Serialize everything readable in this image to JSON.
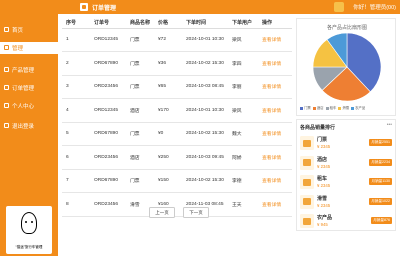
{
  "header": {
    "title": "订单管理",
    "user_greeting": "你好！管理员(00)"
  },
  "sidebar": {
    "items": [
      {
        "label": "首页"
      },
      {
        "label": "管理"
      },
      {
        "label": "产品管理"
      },
      {
        "label": "订单管理"
      },
      {
        "label": "个人中心"
      },
      {
        "label": "退出登录"
      }
    ],
    "slogan": "“猫途”旅行车管理"
  },
  "orders": {
    "columns": [
      "序号",
      "订单号",
      "商品名称",
      "价格",
      "下单时间",
      "下单用户",
      "操作"
    ],
    "rows": [
      {
        "no": "1",
        "order_id": "ORD12345",
        "product": "门票",
        "price": "¥72",
        "time": "2024-10-01 10:30",
        "user": "梁风",
        "action": "查看详情"
      },
      {
        "no": "2",
        "order_id": "ORD67890",
        "product": "门票",
        "price": "¥36",
        "time": "2024-10-02 15:30",
        "user": "李四",
        "action": "查看详情"
      },
      {
        "no": "3",
        "order_id": "ORD23456",
        "product": "门票",
        "price": "¥65",
        "time": "2024-10-03 08:45",
        "user": "李丽",
        "action": "查看详情"
      },
      {
        "no": "4",
        "order_id": "ORD12345",
        "product": "酒店",
        "price": "¥170",
        "time": "2024-10-01 10:30",
        "user": "梁风",
        "action": "查看详情"
      },
      {
        "no": "5",
        "order_id": "ORD67890",
        "product": "门票",
        "price": "¥0",
        "time": "2024-10-02 15:30",
        "user": "魏大",
        "action": "查看详情"
      },
      {
        "no": "6",
        "order_id": "ORD23456",
        "product": "酒店",
        "price": "¥250",
        "time": "2024-10-03 09:45",
        "user": "阿娇",
        "action": "查看详情"
      },
      {
        "no": "7",
        "order_id": "ORD67890",
        "product": "门票",
        "price": "¥150",
        "time": "2024-10-02 15:30",
        "user": "李德",
        "action": "查看详情"
      },
      {
        "no": "8",
        "order_id": "ORD23456",
        "product": "滑雪",
        "price": "¥160",
        "time": "2024-11-03 08:45",
        "user": "王天",
        "action": "查看详情"
      }
    ]
  },
  "pagination": {
    "prev": "上一页",
    "next": "下一页"
  },
  "chart_data": {
    "type": "pie",
    "title": "各产品占比扇形图",
    "categories": [
      "门票",
      "酒店",
      "租车",
      "滑雪",
      "农产品"
    ],
    "values": [
      38,
      25,
      12,
      15,
      10
    ],
    "colors": [
      "#5470c6",
      "#ee7f33",
      "#9aa3ad",
      "#f5c242",
      "#4c9ad8"
    ]
  },
  "ranking": {
    "title": "各商品销量排行",
    "more": "•••",
    "items": [
      {
        "name": "门票",
        "price": "¥ 2345",
        "badge": "月销量2551"
      },
      {
        "name": "酒店",
        "price": "¥ 2345",
        "badge": "月销量2234"
      },
      {
        "name": "租车",
        "price": "¥ 2345",
        "badge": "月销量1130"
      },
      {
        "name": "滑雪",
        "price": "¥ 2345",
        "badge": "月销量1022"
      },
      {
        "name": "农产品",
        "price": "¥ 945",
        "badge": "月销量876"
      }
    ]
  }
}
